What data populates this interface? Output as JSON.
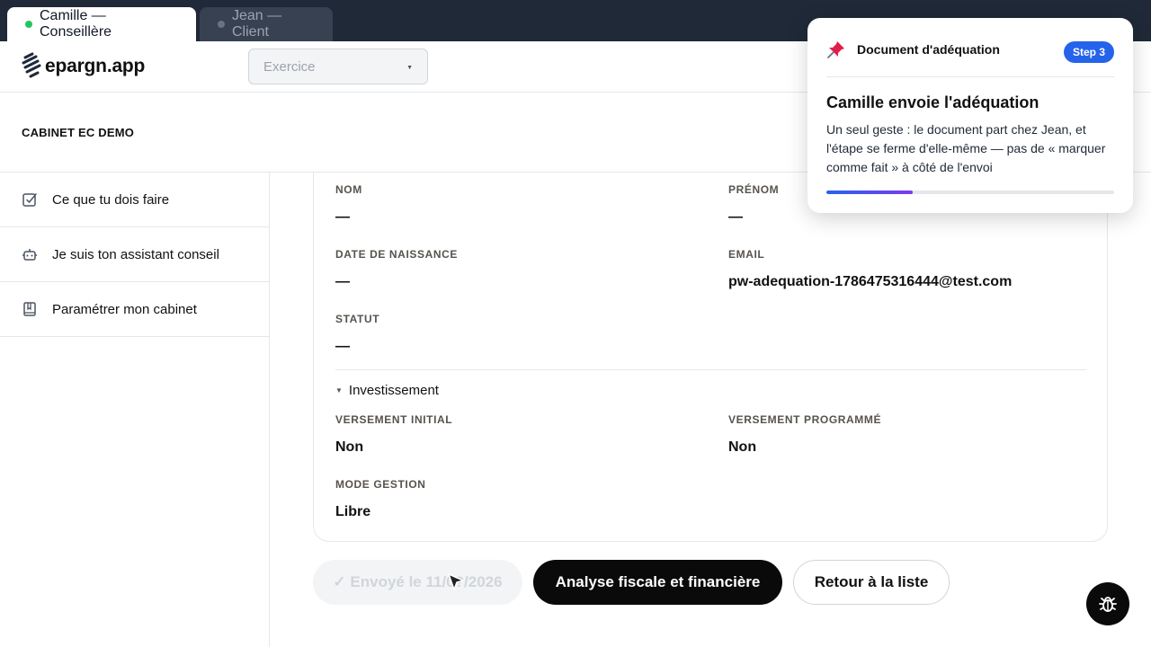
{
  "tabs": [
    {
      "label": "Camille — Conseillère",
      "active": true,
      "status_color": "#22c55e"
    },
    {
      "label": "Jean — Client",
      "active": false,
      "status_color": "#6b7280"
    }
  ],
  "header": {
    "logo_text": "epargn.app",
    "exercise_placeholder": "Exercice"
  },
  "cabinet": {
    "name": "CABINET EC DEMO"
  },
  "sidebar": {
    "items": [
      {
        "label": "Ce que tu dois faire",
        "icon": "checkbox-icon"
      },
      {
        "label": "Je suis ton assistant conseil",
        "icon": "robot-icon"
      },
      {
        "label": "Paramétrer mon cabinet",
        "icon": "book-icon"
      }
    ]
  },
  "client_fields": {
    "nom_label": "NOM",
    "nom_value": "—",
    "prenom_label": "PRÉNOM",
    "prenom_value": "—",
    "naissance_label": "DATE DE NAISSANCE",
    "naissance_value": "—",
    "email_label": "EMAIL",
    "email_value": "pw-adequation-1786475316444@test.com",
    "statut_label": "STATUT",
    "statut_value": "—"
  },
  "investissement": {
    "section_label": "Investissement",
    "versement_initial_label": "VERSEMENT INITIAL",
    "versement_initial_value": "Non",
    "versement_programme_label": "VERSEMENT PROGRAMMÉ",
    "versement_programme_value": "Non",
    "mode_gestion_label": "MODE GESTION",
    "mode_gestion_value": "Libre"
  },
  "actions": {
    "sent_label": "✓ Envoyé le 11/0?/2026",
    "analyse_label": "Analyse fiscale et financière",
    "retour_label": "Retour à la liste"
  },
  "tour": {
    "doc_title": "Document d'adéquation",
    "step_badge": "Step 3",
    "title": "Camille envoie l'adéquation",
    "body": "Un seul geste : le document part chez Jean, et l'étape se ferme d'elle-même — pas de « marquer comme fait » à côté de l'envoi",
    "progress_fraction": 0.3,
    "accent_color": "#2563eb"
  },
  "colors": {
    "primary_dark": "#0a0a0a",
    "tabbar_bg": "#1f2937"
  }
}
